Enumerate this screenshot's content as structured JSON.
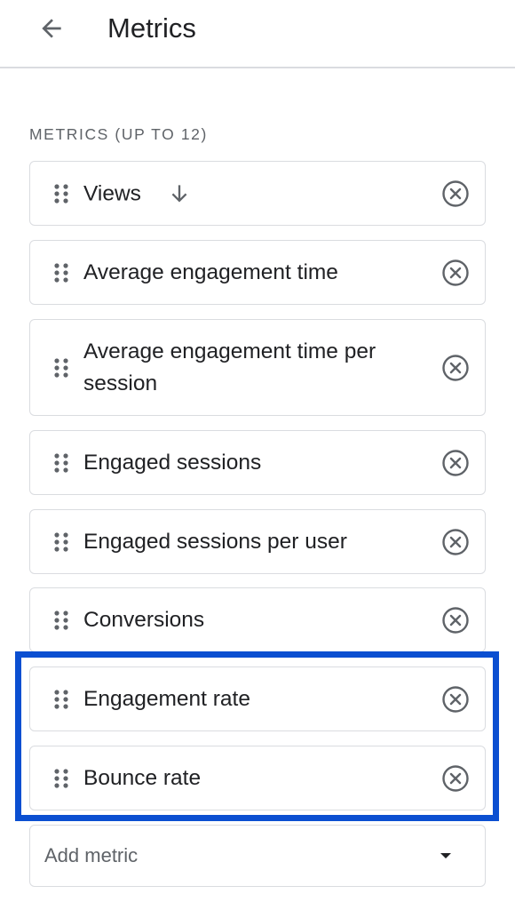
{
  "header": {
    "back_icon": "arrow-left-icon",
    "title": "Metrics"
  },
  "section": {
    "label": "METRICS (UP TO 12)"
  },
  "metrics": [
    {
      "label": "Views",
      "sorted": true,
      "sort_icon": "arrow-down-icon"
    },
    {
      "label": "Average engagement time"
    },
    {
      "label": "Average engagement time per session"
    },
    {
      "label": "Engaged sessions"
    },
    {
      "label": "Engaged sessions per user"
    },
    {
      "label": "Conversions"
    },
    {
      "label": "Engagement rate"
    },
    {
      "label": "Bounce rate"
    }
  ],
  "metric_icons": {
    "drag": "drag-handle-icon",
    "remove": "remove-circle-icon"
  },
  "add_metric": {
    "placeholder": "Add metric",
    "icon": "caret-down-icon"
  },
  "colors": {
    "highlight": "#0b4fd1",
    "border": "#dadce0",
    "text": "#202124",
    "muted": "#5f6368",
    "icon": "#5f6368"
  }
}
